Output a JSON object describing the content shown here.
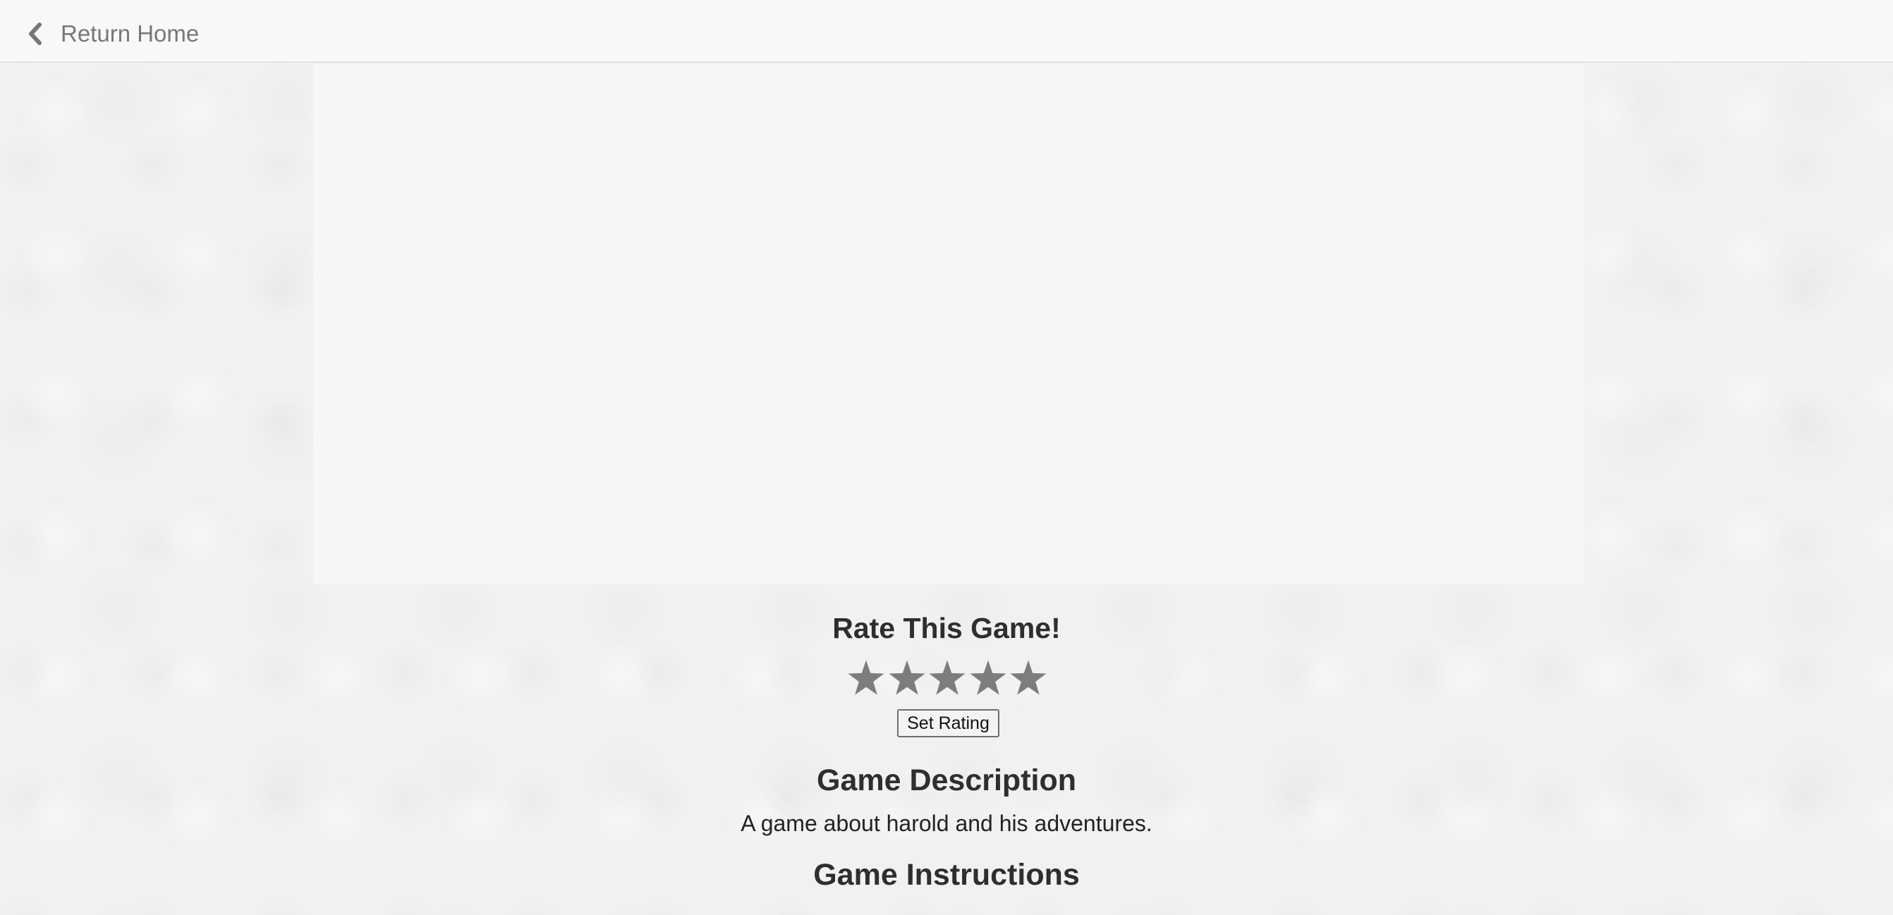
{
  "nav": {
    "back_icon": "chevron-left-icon",
    "return_label": "Return Home"
  },
  "rating": {
    "title": "Rate This Game!",
    "star_icon": "star-icon",
    "star_color": "#7d7d7d",
    "max_stars": 5,
    "button_label": "Set Rating"
  },
  "description": {
    "title": "Game Description",
    "text": "A game about harold and his adventures."
  },
  "instructions": {
    "title": "Game Instructions"
  }
}
